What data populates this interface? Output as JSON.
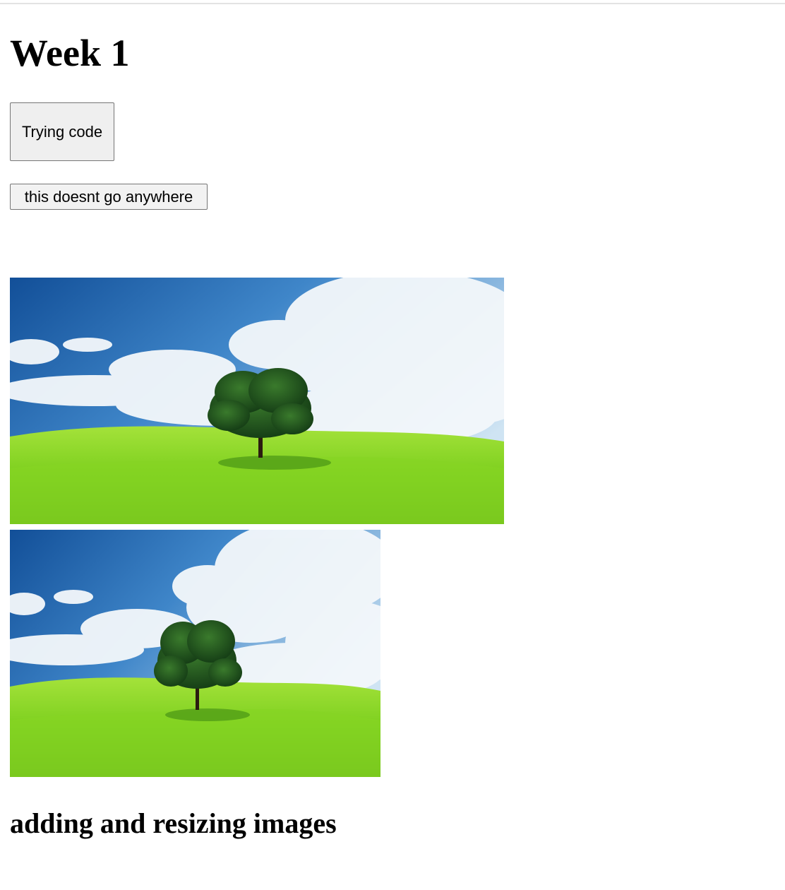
{
  "page": {
    "title": "Week 1",
    "buttons": {
      "trying_code": "Trying code",
      "does_not_go_anywhere": "this doesnt go anywhere"
    },
    "images": [
      {
        "subject": "lone-tree-meadow-under-cloudy-sky"
      },
      {
        "subject": "lone-tree-meadow-under-cloudy-sky"
      }
    ],
    "section_heading": "adding and resizing images"
  },
  "colors": {
    "page_background": "#ffffff",
    "button_background": "#efefef",
    "button_border": "#767676",
    "sky_top": "#1b5fa8",
    "grass": "#7ccf1e",
    "tree": "#1f4e1c"
  }
}
